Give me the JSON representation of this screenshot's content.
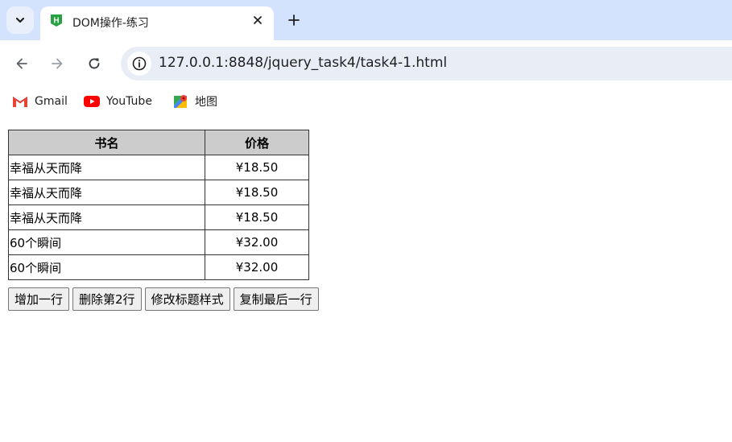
{
  "browser": {
    "tab": {
      "title": "DOM操作-练习"
    },
    "address_bar": {
      "url": "127.0.0.1:8848/jquery_task4/task4-1.html"
    },
    "bookmarks": [
      {
        "label": "Gmail",
        "icon": "gmail-icon"
      },
      {
        "label": "YouTube",
        "icon": "youtube-icon"
      },
      {
        "label": "地图",
        "icon": "maps-icon"
      }
    ],
    "colors": {
      "tabstrip_bg": "#d3e3fd",
      "omnibox_bg": "#e9eef6",
      "favicon_green": "#27a243"
    }
  },
  "page": {
    "table": {
      "headers": [
        "书名",
        "价格"
      ],
      "rows": [
        [
          "幸福从天而降",
          "¥18.50"
        ],
        [
          "幸福从天而降",
          "¥18.50"
        ],
        [
          "幸福从天而降",
          "¥18.50"
        ],
        [
          "60个瞬间",
          "¥32.00"
        ],
        [
          "60个瞬间",
          "¥32.00"
        ]
      ]
    },
    "buttons": {
      "add_row": "增加一行",
      "delete_second": "删除第2行",
      "modify_header": "修改标题样式",
      "copy_last": "复制最后一行"
    }
  }
}
